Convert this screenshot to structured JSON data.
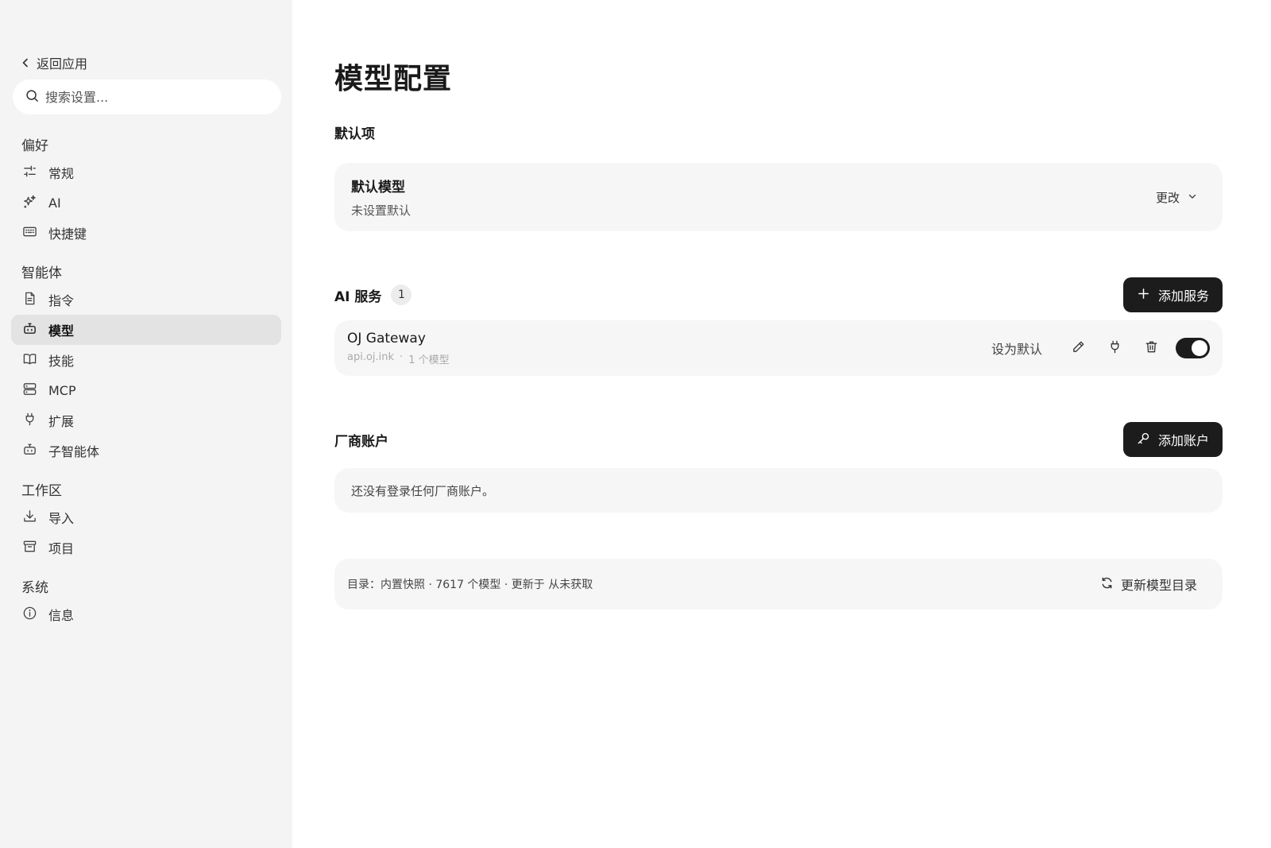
{
  "sidebar": {
    "back_label": "返回应用",
    "search_placeholder": "搜索设置...",
    "groups": [
      {
        "title": "偏好",
        "items": [
          {
            "label": "常规",
            "icon": "sliders-icon"
          },
          {
            "label": "AI",
            "icon": "sparkles-icon"
          },
          {
            "label": "快捷键",
            "icon": "keyboard-icon"
          }
        ]
      },
      {
        "title": "智能体",
        "items": [
          {
            "label": "指令",
            "icon": "document-icon"
          },
          {
            "label": "模型",
            "icon": "bot-icon",
            "active": true
          },
          {
            "label": "技能",
            "icon": "book-icon"
          },
          {
            "label": "MCP",
            "icon": "server-icon"
          },
          {
            "label": "扩展",
            "icon": "plug-icon"
          },
          {
            "label": "子智能体",
            "icon": "bot-icon"
          }
        ]
      },
      {
        "title": "工作区",
        "items": [
          {
            "label": "导入",
            "icon": "download-icon"
          },
          {
            "label": "项目",
            "icon": "archive-icon"
          }
        ]
      },
      {
        "title": "系统",
        "items": [
          {
            "label": "信息",
            "icon": "info-icon"
          }
        ]
      }
    ]
  },
  "main": {
    "title": "模型配置",
    "defaults": {
      "section_title": "默认项",
      "model_label": "默认模型",
      "model_value": "未设置默认",
      "change_label": "更改"
    },
    "services": {
      "section_title": "AI 服务",
      "count": "1",
      "add_label": "添加服务",
      "items": [
        {
          "name": "OJ Gateway",
          "host": "api.oj.ink",
          "separator": "·",
          "models": "1 个模型",
          "set_default_label": "设为默认",
          "enabled": true
        }
      ]
    },
    "vendors": {
      "section_title": "厂商账户",
      "add_label": "添加账户",
      "empty_text": "还没有登录任何厂商账户。"
    },
    "catalog": {
      "text": "目录：内置快照 · 7617 个模型 · 更新于 从未获取",
      "refresh_label": "更新模型目录"
    }
  },
  "colors": {
    "sidebar_bg": "#f4f4f4",
    "active_item_bg": "#e3e3e3",
    "card_bg": "#f6f6f6",
    "dark_button": "#1c1c1c"
  }
}
